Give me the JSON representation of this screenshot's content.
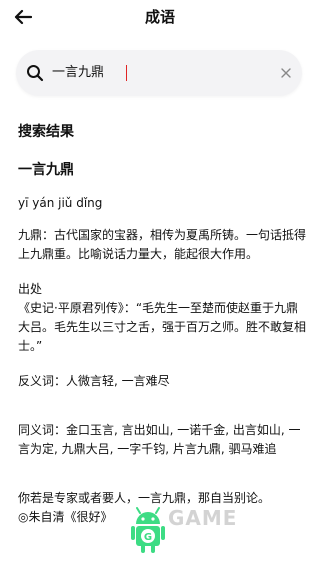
{
  "header": {
    "title": "成语",
    "back_icon": "arrow-left-icon"
  },
  "search": {
    "value": "一言九鼎",
    "search_icon": "search-icon",
    "clear_icon": "close-icon"
  },
  "results": {
    "section_title": "搜索结果",
    "word": "一言九鼎",
    "pinyin": "yī yán jiǔ dǐng",
    "definition": "九鼎：古代国家的宝器，相传为夏禹所铸。一句话抵得上九鼎重。比喻说话力量大，能起很大作用。",
    "source_label": "出处",
    "source_text": "《史记·平原君列传》：“毛先生一至楚而使赵重于九鼎大吕。毛先生以三寸之舌，强于百万之师。胜不敢复相士。”",
    "antonyms": "反义词：人微言轻, 一言难尽",
    "synonyms": "同义词：金口玉言, 言出如山, 一诺千金, 出言如山, 一言为定, 九鼎大吕, 一字千钧, 片言九鼎, 驷马难追",
    "example": "你若是专家或者要人，一言九鼎，那自当别论。",
    "example_source": "◎朱自清《很好》"
  },
  "watermark": {
    "text": "GAME",
    "icon": "android-icon",
    "color": "#3ddc84"
  }
}
